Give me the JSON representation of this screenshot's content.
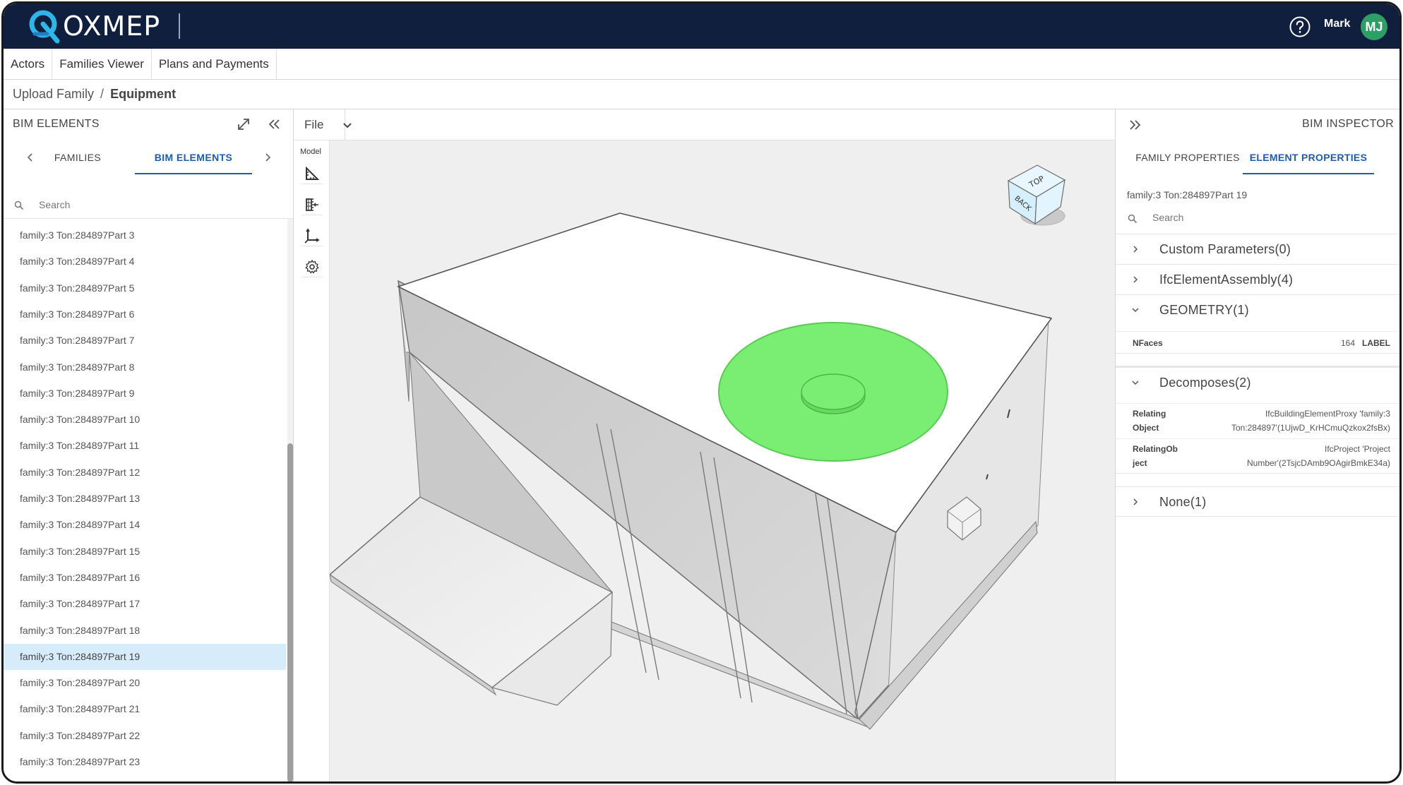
{
  "app": {
    "logo_text": "OXMEP",
    "user_name": "Mark",
    "user_initials": "MJ",
    "colors": {
      "header_bg": "#0f1f3d",
      "accent": "#1e5ca8",
      "highlight": "#7aee73",
      "avatar": "#2e9e67"
    }
  },
  "nav": {
    "tabs": [
      {
        "label": "Actors"
      },
      {
        "label": "Families Viewer"
      },
      {
        "label": "Plans and Payments"
      }
    ]
  },
  "breadcrumb": {
    "parent": "Upload Family",
    "separator": "/",
    "current": "Equipment"
  },
  "left_panel": {
    "title": "BIM ELEMENTS",
    "tabs": [
      {
        "label": "FAMILIES"
      },
      {
        "label": "BIM ELEMENTS",
        "active": true
      }
    ],
    "search_placeholder": "Search",
    "items": [
      "family:3 Ton:284897Part 3",
      "family:3 Ton:284897Part 4",
      "family:3 Ton:284897Part 5",
      "family:3 Ton:284897Part 6",
      "family:3 Ton:284897Part 7",
      "family:3 Ton:284897Part 8",
      "family:3 Ton:284897Part 9",
      "family:3 Ton:284897Part 10",
      "family:3 Ton:284897Part 11",
      "family:3 Ton:284897Part 12",
      "family:3 Ton:284897Part 13",
      "family:3 Ton:284897Part 14",
      "family:3 Ton:284897Part 15",
      "family:3 Ton:284897Part 16",
      "family:3 Ton:284897Part 17",
      "family:3 Ton:284897Part 18",
      "family:3 Ton:284897Part 19",
      "family:3 Ton:284897Part 20",
      "family:3 Ton:284897Part 21",
      "family:3 Ton:284897Part 22",
      "family:3 Ton:284897Part 23"
    ],
    "selected_index": 16
  },
  "viewport": {
    "file_menu": "File",
    "tools_label": "Model",
    "tools": [
      "measure-icon",
      "section-icon",
      "axes-icon",
      "settings-icon"
    ],
    "nav_cube": {
      "top_label": "TOP",
      "front_label": "BACK"
    }
  },
  "right_panel": {
    "title": "BIM INSPECTOR",
    "tabs": [
      {
        "label": "FAMILY PROPERTIES"
      },
      {
        "label": "ELEMENT PROPERTIES",
        "active": true
      }
    ],
    "element_name": "family:3 Ton:284897Part 19",
    "search_placeholder": "Search",
    "sections": {
      "custom": "Custom Parameters(0)",
      "assembly": "IfcElementAssembly(4)",
      "geometry": "GEOMETRY(1)",
      "decomposes": "Decomposes(2)",
      "none": "None(1)"
    },
    "geometry_props": {
      "key": "NFaces",
      "value": "164",
      "tag": "LABEL"
    },
    "decomposes_props": [
      {
        "key1": "Relating",
        "key2": "Object",
        "val1": "IfcBuildingElementProxy 'family:3",
        "val2": "Ton:284897'(1UjwD_KrHCmuQzkox2fsBx)"
      },
      {
        "key1": "RelatingOb",
        "key2": "ject",
        "val1": "IfcProject 'Project",
        "val2": "Number'(2TsjcDAmb9OAgirBmkE34a)"
      }
    ]
  }
}
